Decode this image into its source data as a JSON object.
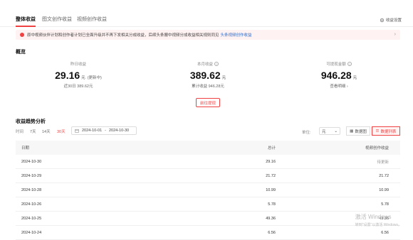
{
  "tabs": [
    "整体收益",
    "图文创作收益",
    "视频创作收益"
  ],
  "settings_label": "收益设置",
  "notice": {
    "text": "原中视频伙伴计划和创作者计划已全面升级并不再下发相关分成收益，后续头条搬中视频分成收益相关规则同见",
    "link": "头条视频创作收益"
  },
  "overview": {
    "title": "概览",
    "yesterday": {
      "label": "昨日收益",
      "value": "29.16",
      "unit": "元",
      "note": "(更新中)",
      "sub": "近30日 389.62元"
    },
    "month": {
      "label": "本月收益",
      "value": "389.62",
      "unit": "元",
      "sub": "累计收益 946.28元"
    },
    "withdrawable": {
      "label": "可提现金额",
      "value": "946.28",
      "unit": "元",
      "sub": "查看明细 ›"
    },
    "withdraw_button": "前往提现"
  },
  "trend": {
    "title": "收益趋势分析",
    "time_label": "时间",
    "filters": [
      "7天",
      "14天",
      "30天"
    ],
    "active_filter": "30天",
    "date_start": "2024-10-01",
    "date_sep": "-",
    "date_end": "2024-10-30",
    "unit_label": "单位:",
    "unit_value": "元",
    "view_chart": "数据图",
    "view_table": "数据列表"
  },
  "table": {
    "headers": {
      "date": "日期",
      "total": "总计",
      "video": "视频创作收益"
    },
    "rows": [
      {
        "date": "2024-10-30",
        "total": "29.16",
        "video": "待更新"
      },
      {
        "date": "2024-10-29",
        "total": "21.72",
        "video": "21.72"
      },
      {
        "date": "2024-10-28",
        "total": "10.99",
        "video": "10.99"
      },
      {
        "date": "2024-10-26",
        "total": "5.78",
        "video": "5.78"
      },
      {
        "date": "2024-10-25",
        "total": "49.36",
        "video": "49.36"
      },
      {
        "date": "2024-10-24",
        "total": "6.56",
        "video": "6.56"
      }
    ]
  },
  "watermark": {
    "line1": "激活 Windows",
    "line2": "转到\"设置\"以激活 Windows。"
  },
  "colors": {
    "accent": "#f04142",
    "link": "#2d6fd2",
    "notice_bg": "#fff2f2"
  }
}
